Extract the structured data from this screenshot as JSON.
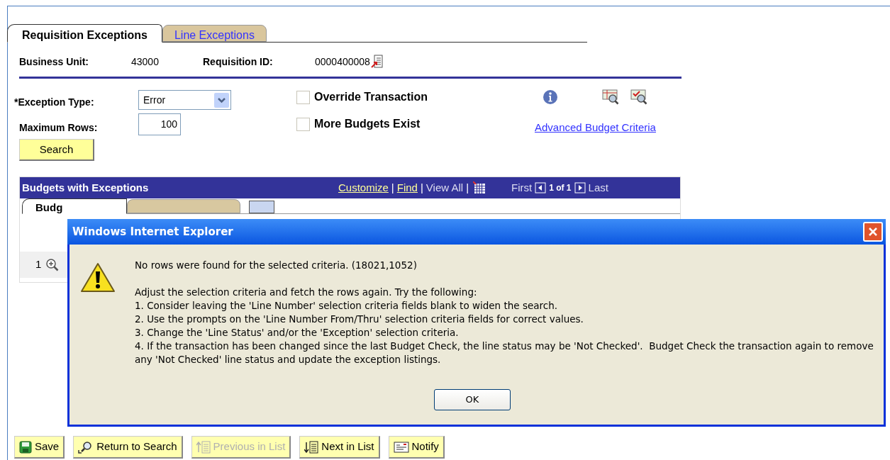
{
  "tabs": [
    {
      "label": "Requisition Exceptions",
      "selected": true
    },
    {
      "label": "Line Exceptions",
      "selected": false
    }
  ],
  "header": {
    "business_unit_label": "Business Unit:",
    "business_unit": "43000",
    "requisition_id_label": "Requisition ID:",
    "requisition_id": "0000400008"
  },
  "filters": {
    "exception_type": {
      "label": "*Exception Type:",
      "value": "Error"
    },
    "maximum_rows": {
      "label": "Maximum Rows:",
      "value": "100"
    },
    "checkboxes": [
      {
        "label": "Override Transaction",
        "checked": false
      },
      {
        "label": "More Budgets Exist",
        "checked": false
      }
    ],
    "search_button": "Search",
    "link": "Advanced Budget Criteria"
  },
  "grid": {
    "title": "Budgets with Exceptions",
    "links": [
      "Customize",
      "Find"
    ],
    "separators": [
      "|",
      "|",
      "|"
    ],
    "view_all": "View All",
    "first": "First",
    "range": "1 of 1",
    "last": "Last",
    "tabs": [
      {
        "label": "Budg",
        "selected": true
      }
    ],
    "rows": [
      {
        "number": "1"
      }
    ]
  },
  "dialog": {
    "title": "Windows Internet Explorer",
    "message": "No rows were found for the selected criteria. (18021,1052)",
    "details": "Adjust the selection criteria and fetch the rows again. Try the following:",
    "steps": [
      "1. Consider leaving the 'Line Number' selection criteria fields blank to widen the search.",
      "2. Use the prompts on the 'Line Number From/Thru' selection criteria fields for correct values.",
      "3. Change the 'Line Status' and/or the 'Exception' selection criteria.",
      "4. If the transaction has been changed since the last Budget Check, the line status may be 'Not Checked'.  Budget Check the transaction again to remove any 'Not Checked' line status and update the exception listings."
    ],
    "button": "OK"
  },
  "buttons": [
    {
      "kind": "save",
      "label": "Save",
      "disabled": false
    },
    {
      "kind": "search",
      "label": "Return to Search",
      "disabled": false
    },
    {
      "kind": "previous",
      "label": "Previous in List",
      "disabled": true
    },
    {
      "kind": "next",
      "label": "Next in List",
      "disabled": false
    },
    {
      "kind": "notify",
      "label": "Notify",
      "disabled": false
    }
  ]
}
